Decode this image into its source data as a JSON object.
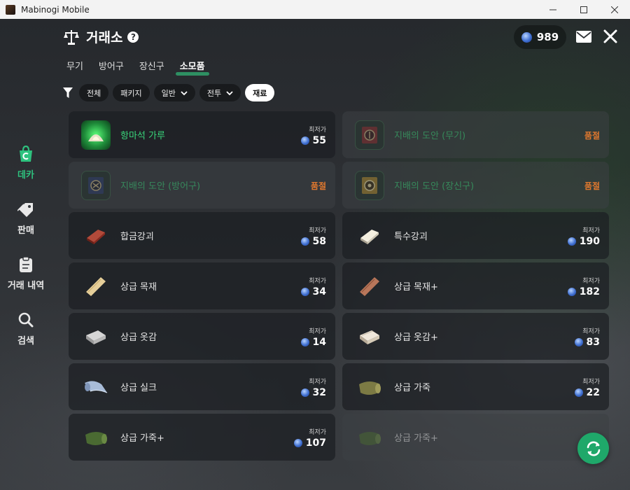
{
  "window": {
    "title": "Mabinogi Mobile"
  },
  "header": {
    "title": "거래소",
    "help": "?",
    "currency": "989"
  },
  "sidebar": {
    "items": [
      {
        "label": "데카",
        "active": true
      },
      {
        "label": "판매",
        "active": false
      },
      {
        "label": "거래 내역",
        "active": false
      },
      {
        "label": "검색",
        "active": false
      }
    ]
  },
  "tabs": [
    {
      "label": "무기",
      "active": false
    },
    {
      "label": "방어구",
      "active": false
    },
    {
      "label": "장신구",
      "active": false
    },
    {
      "label": "소모품",
      "active": true
    }
  ],
  "filters": [
    {
      "label": "전체",
      "dropdown": false,
      "active": false
    },
    {
      "label": "패키지",
      "dropdown": false,
      "active": false
    },
    {
      "label": "일반",
      "dropdown": true,
      "active": false
    },
    {
      "label": "전투",
      "dropdown": true,
      "active": false
    },
    {
      "label": "재료",
      "dropdown": false,
      "active": true
    }
  ],
  "price_label": "최저가",
  "items": [
    {
      "name": "항마석 가루",
      "price": "55",
      "soldout": "",
      "icon": "magic-stone-powder-icon"
    },
    {
      "name": "지배의 도안 (무기)",
      "price": "",
      "soldout": "품절",
      "icon": "blueprint-weapon-icon"
    },
    {
      "name": "지배의 도안 (방어구)",
      "price": "",
      "soldout": "품절",
      "icon": "blueprint-armor-icon"
    },
    {
      "name": "지배의 도안 (장신구)",
      "price": "",
      "soldout": "품절",
      "icon": "blueprint-accessory-icon"
    },
    {
      "name": "합금강괴",
      "price": "58",
      "soldout": "",
      "icon": "alloy-ingot-icon"
    },
    {
      "name": "특수강괴",
      "price": "190",
      "soldout": "",
      "icon": "special-ingot-icon"
    },
    {
      "name": "상급 목재",
      "price": "34",
      "soldout": "",
      "icon": "wood-plank-icon"
    },
    {
      "name": "상급 목재+",
      "price": "182",
      "soldout": "",
      "icon": "wood-plank-plus-icon"
    },
    {
      "name": "상급 옷감",
      "price": "14",
      "soldout": "",
      "icon": "cloth-icon"
    },
    {
      "name": "상급 옷감+",
      "price": "83",
      "soldout": "",
      "icon": "cloth-plus-icon"
    },
    {
      "name": "상급 실크",
      "price": "32",
      "soldout": "",
      "icon": "silk-icon"
    },
    {
      "name": "상급 가죽",
      "price": "22",
      "soldout": "",
      "icon": "leather-icon"
    },
    {
      "name": "상급 가죽+",
      "price": "107",
      "soldout": "",
      "icon": "leather-plus-icon"
    },
    {
      "name": "상급 가죽+",
      "price": "",
      "soldout": "",
      "icon": "leather-plus-icon"
    }
  ],
  "colors": {
    "accent_green": "#1fa86a",
    "soldout_orange": "#e0782e",
    "coin_blue": "#3f6fd1"
  }
}
